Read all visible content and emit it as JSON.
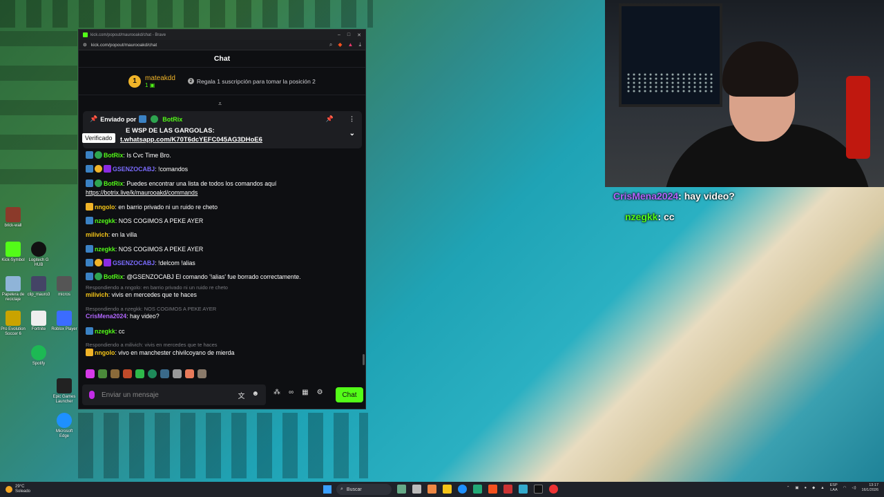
{
  "browser": {
    "title": "kick.com/popout/maurooakd/chat - Brave",
    "url": "kick.com/popout/maurooakd/chat"
  },
  "chat": {
    "header": "Chat",
    "leader": {
      "rank": "1",
      "username": "mateakdd",
      "subs": "1",
      "gift_text": "Regala 1 suscripción para tomar la posición 2",
      "gift_num": "2"
    },
    "pinned": {
      "sent_by": "Enviado por",
      "author": "BotRix",
      "text": "E WSP DE LAS GARGOLAS:",
      "link": "t.whatsapp.com/K70T6dcYEFC045AG3DHoE6",
      "tooltip": "Verificado"
    },
    "messages": [
      {
        "user": "BotRix",
        "text": ": Is Cvc Time Bro.",
        "cls": "u-bot"
      },
      {
        "user": "GSENZOCABJ",
        "text": ": !comandos",
        "cls": "u-gs"
      },
      {
        "user": "BotRix",
        "text": ": Puedes encontrar una lista de todos los comandos aquí",
        "cls": "u-bot"
      },
      {
        "link": "https://botrix.live/k/maurooakd/commands"
      },
      {
        "user": "nngolo",
        "text": ": en barrio privado ni un ruido re cheto",
        "cls": "u-ng"
      },
      {
        "user": "nzegkk",
        "text": ": NOS COGIMOS A PEKE AYER",
        "cls": "u-nz"
      },
      {
        "user": "milivich",
        "text": ": en la villa",
        "cls": "u-mi"
      },
      {
        "user": "nzegkk",
        "text": ": NOS COGIMOS A PEKE AYER",
        "cls": "u-nz"
      },
      {
        "user": "GSENZOCABJ",
        "text": ": !delcom !alias",
        "cls": "u-gs"
      },
      {
        "user": "BotRix",
        "text": ": @GSENZOCABJ El comando '!alias' fue borrado correctamente.",
        "cls": "u-bot"
      },
      {
        "reply": "Respondiendo a nngolo: en barrio privado ni un ruido re cheto"
      },
      {
        "user": "milivich",
        "text": ": vivis en mercedes que te haces",
        "cls": "u-mi"
      },
      {
        "reply": "Respondiendo a nzegkk: NOS COGIMOS A PEKE AYER"
      },
      {
        "user": "CrisMena2024",
        "text": ": hay video?",
        "cls": "u-cr"
      },
      {
        "user": "nzegkk",
        "text": ": cc",
        "cls": "u-nz"
      },
      {
        "reply": "Respondiendo a milivich: vivis en mercedes que te haces"
      },
      {
        "user": "nngolo",
        "text": ": vivo en manchester chivilcoyano de mierda",
        "cls": "u-ng"
      }
    ],
    "input_placeholder": "Enviar un mensaje",
    "send_label": "Chat"
  },
  "overlay": [
    {
      "user": "CrisMena2024",
      "text": ": hay video?"
    },
    {
      "user": "nzegkk",
      "text": ": cc"
    }
  ],
  "desktop_icons": [
    "Papelera de reciclaje",
    "Logitech G HUB",
    "Kick-Symbol",
    "Pro Evolution Soccer 6",
    "Fortnite",
    "Roblox Player",
    "Spotify",
    "Epic Games Launcher",
    "Microsoft Edge",
    "brick-wall",
    "micros",
    "clip_mauro3"
  ],
  "taskbar": {
    "weather_temp": "29°C",
    "weather_desc": "Soleado",
    "search": "Buscar",
    "lang": "ESP",
    "lang2": "LAA",
    "time": "13:17",
    "date": "16/1/2026"
  }
}
